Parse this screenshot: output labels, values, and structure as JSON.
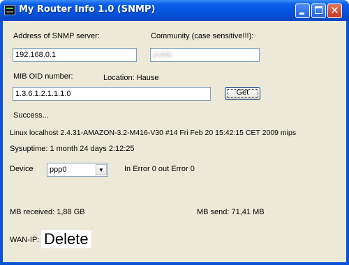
{
  "window": {
    "title": "My Router Info 1.0 (SNMP)"
  },
  "form": {
    "address_label": "Address of SNMP server:",
    "address_value": "192.168.0.1",
    "community_label": "Community (case sensitive!!!):",
    "community_value": "public",
    "mib_label": "MIB OID number:",
    "location_label": "Location: Hause",
    "mib_value": "1.3.6.1.2.1.1.1.0",
    "get_label": "Get"
  },
  "status": {
    "result": "Success...",
    "system_desc": "Linux localhost 2.4.31-AMAZON-3.2-M416-V30 #14 Fri Feb 20 15:42:15 CET 2009 mips",
    "sysuptime": "Sysuptime: 1 month 24 days 2:12:25"
  },
  "device": {
    "label": "Device",
    "selected": "ppp0",
    "errors": "In Error 0 out Error 0"
  },
  "traffic": {
    "received": "MB received: 1,88 GB",
    "sent": "MB send: 71,41 MB"
  },
  "wan": {
    "label": "WAN-IP:",
    "value": "Delete"
  },
  "icons": {
    "app": "router-app-icon",
    "minimize": "minimize-icon",
    "maximize": "maximize-icon",
    "close": "close-icon",
    "dropdown": "chevron-down-icon"
  },
  "colors": {
    "titlebar": "#0552dc",
    "client_bg": "#ece9d8",
    "close_button": "#c8361e"
  }
}
